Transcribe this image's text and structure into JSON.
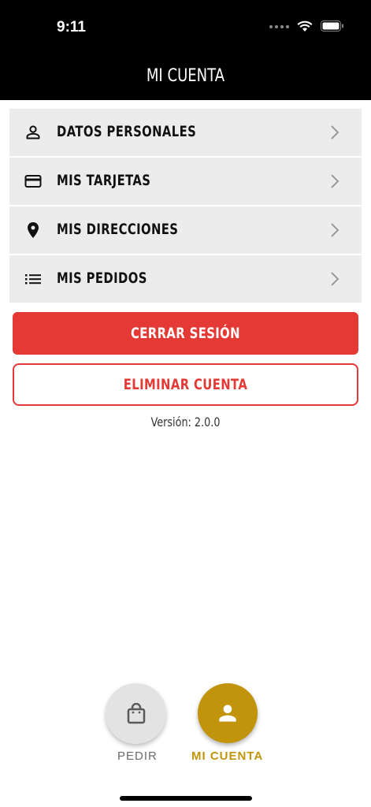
{
  "status_bar": {
    "time": "9:11"
  },
  "header": {
    "title": "MI CUENTA"
  },
  "menu": {
    "items": [
      {
        "label": "DATOS PERSONALES",
        "icon": "person-icon"
      },
      {
        "label": "MIS TARJETAS",
        "icon": "credit-card-icon"
      },
      {
        "label": "MIS DIRECCIONES",
        "icon": "location-pin-icon"
      },
      {
        "label": "MIS PEDIDOS",
        "icon": "list-icon"
      }
    ]
  },
  "actions": {
    "logout_label": "CERRAR SESIÓN",
    "delete_label": "ELIMINAR CUENTA"
  },
  "version": "Versión: 2.0.0",
  "bottom_nav": {
    "items": [
      {
        "label": "PEDIR",
        "icon": "shopping-bag-icon",
        "active": false
      },
      {
        "label": "MI CUENTA",
        "icon": "person-icon",
        "active": true
      }
    ]
  },
  "colors": {
    "accent": "#c1940b",
    "danger": "#e53935",
    "header_bg": "#000000",
    "menu_bg": "#ececec"
  }
}
